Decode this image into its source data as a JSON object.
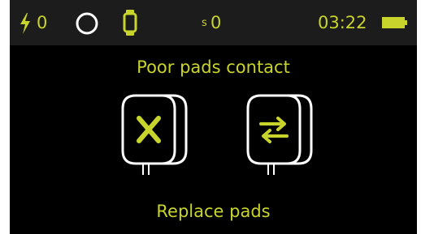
{
  "status": {
    "shock_count": "0",
    "seconds_label": "s",
    "seconds_value": "0",
    "time": "03:22",
    "icons": [
      "lightning-bolt-icon",
      "circle-icon",
      "watch-icon",
      "battery-icon"
    ]
  },
  "alert": {
    "title": "Poor pads contact",
    "instruction": "Replace pads",
    "pads": [
      "pads-error-icon",
      "pads-swap-icon"
    ]
  },
  "colors": {
    "accent": "#c8d42b",
    "background": "#000000",
    "status_bar": "#1c1c1c",
    "outline": "#ffffff"
  }
}
